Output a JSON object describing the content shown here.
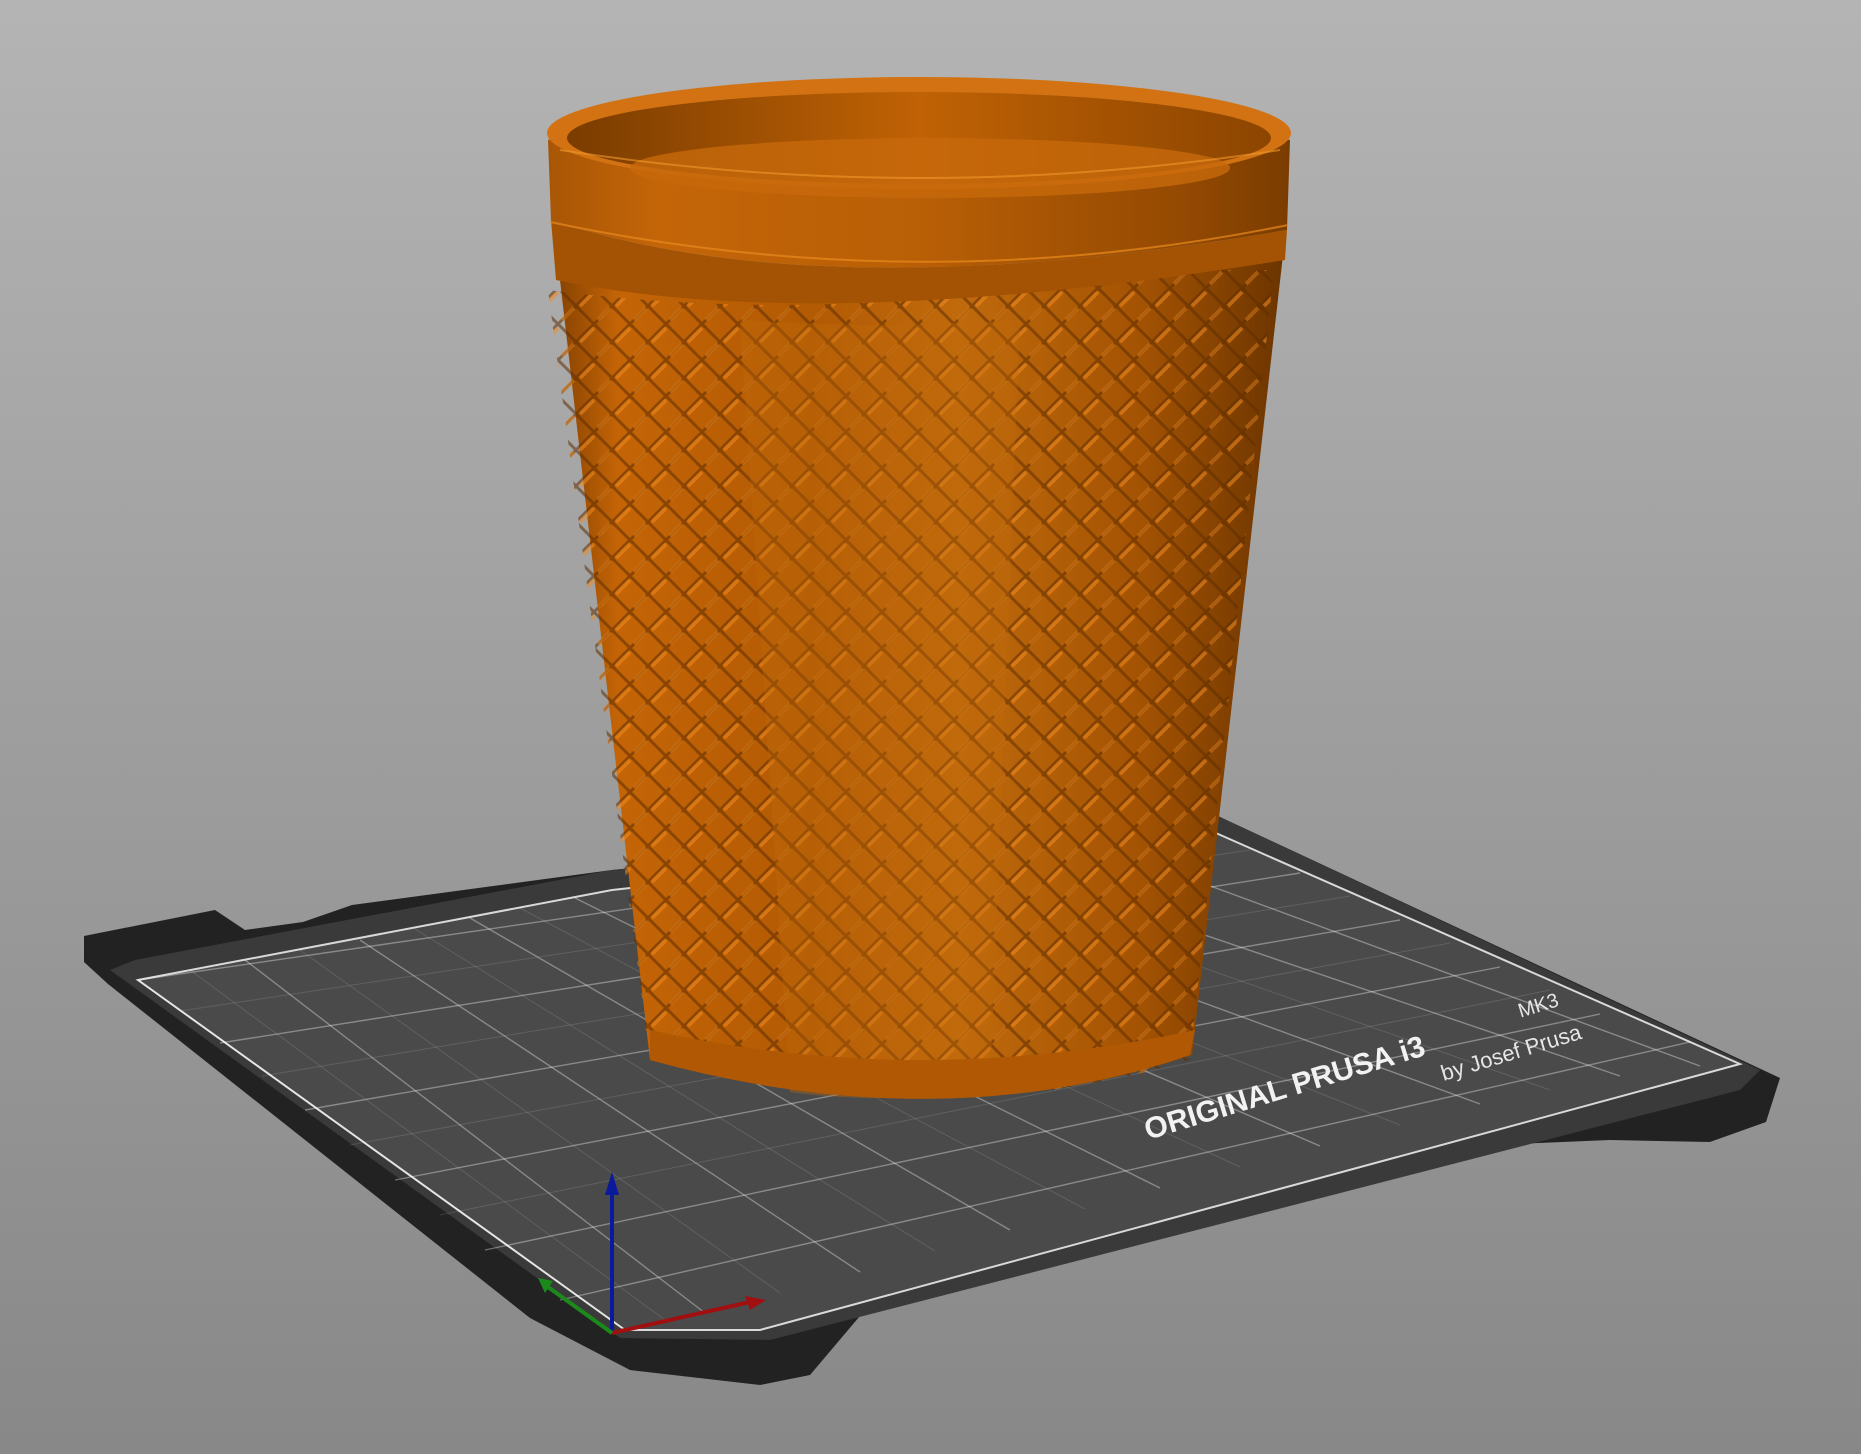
{
  "viewport": {
    "background_top": "#b4b4b4",
    "background_bottom": "#8a8a8a"
  },
  "bed": {
    "brand_label": "ORIGINAL PRUSA i3",
    "model_label": "MK3",
    "maker_label": "by Josef Prusa",
    "plate_color": "#2a2a2a",
    "grid_color": "#ffffff"
  },
  "object": {
    "shape": "knurled-cup",
    "color": "#c96a0a"
  },
  "axes": {
    "x_color": "#a01010",
    "y_color": "#1b8a1b",
    "z_color": "#0a1a9a"
  }
}
